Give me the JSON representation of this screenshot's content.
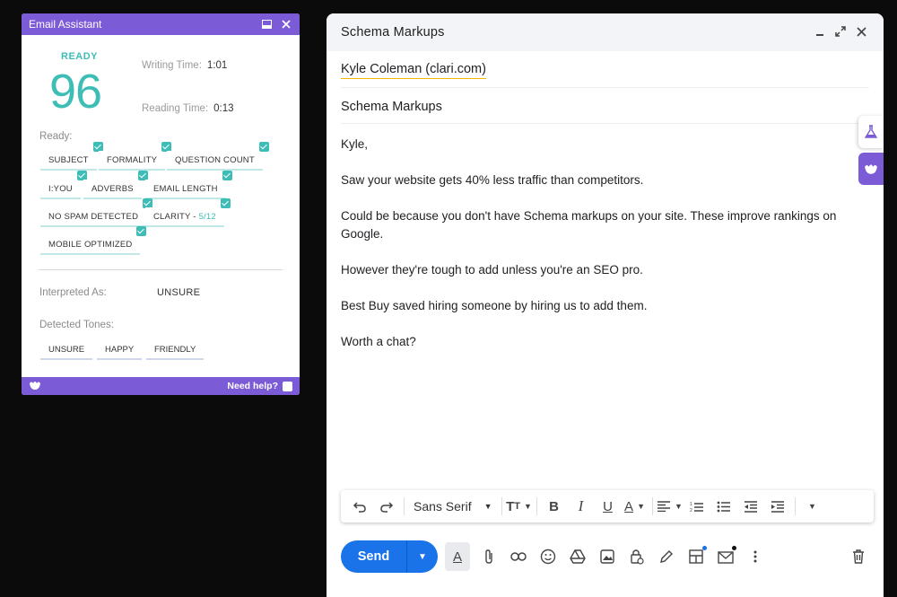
{
  "assistant": {
    "title": "Email Assistant",
    "status": "READY",
    "score": "96",
    "writing_time_label": "Writing Time:",
    "writing_time": "1:01",
    "reading_time_label": "Reading Time:",
    "reading_time": "0:13",
    "ready_label": "Ready:",
    "checks": [
      "SUBJECT",
      "FORMALITY",
      "QUESTION COUNT",
      "I:YOU",
      "ADVERBS",
      "EMAIL LENGTH",
      "NO SPAM DETECTED",
      "CLARITY -",
      "MOBILE OPTIMIZED"
    ],
    "clarity_score": "5/12",
    "interpreted_label": "Interpreted As:",
    "interpreted_value": "UNSURE",
    "tones_label": "Detected Tones:",
    "tones": [
      "UNSURE",
      "HAPPY",
      "FRIENDLY"
    ],
    "help": "Need help?",
    "accent": "#7b5bd6",
    "teal": "#3dbdb6"
  },
  "compose": {
    "title": "Schema Markups",
    "to": "Kyle Coleman (clari.com)",
    "subject": "Schema Markups",
    "body": [
      "Kyle,",
      "Saw your website gets 40% less traffic than competitors.",
      "Could be because you don't have Schema markups on your site. These improve rankings on Google.",
      "However they're tough to add unless you're an SEO pro.",
      "Best Buy saved hiring someone by hiring us to add them.",
      "Worth a chat?"
    ],
    "font": "Sans Serif",
    "send_label": "Send",
    "send_color": "#1a73e8"
  }
}
